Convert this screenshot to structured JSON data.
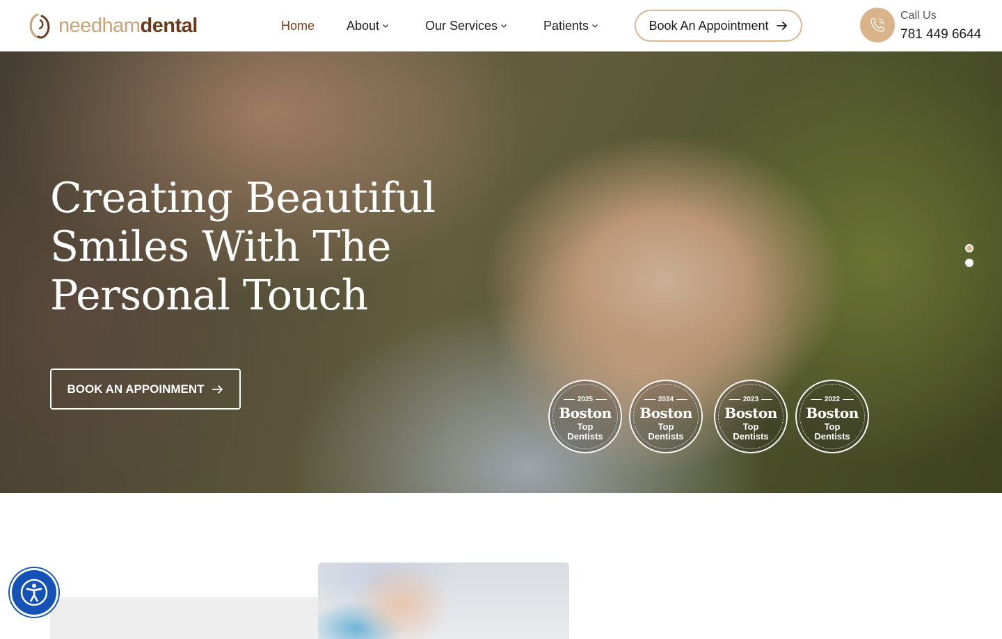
{
  "brand": {
    "logo_part1": "needham",
    "logo_part2": "dental",
    "colors": {
      "accent": "#d9b38a",
      "brand_dark": "#6a3b1a",
      "brand_light": "#c7a27a",
      "accessibility": "#1552b8"
    }
  },
  "nav": {
    "items": [
      {
        "label": "Home",
        "active": true,
        "dropdown": false
      },
      {
        "label": "About",
        "active": false,
        "dropdown": true
      },
      {
        "label": "Our Services",
        "active": false,
        "dropdown": true
      },
      {
        "label": "Patients",
        "active": false,
        "dropdown": true
      }
    ],
    "cta_label": "Book An Appointment"
  },
  "contact": {
    "label": "Call Us",
    "phone": "781 449 6644",
    "icon": "phone-icon"
  },
  "hero": {
    "title_lines": [
      "Creating Beautiful",
      "Smiles With The",
      "Personal Touch"
    ],
    "cta_label": "BOOK AN APPOINMENT",
    "slides": {
      "count": 2,
      "active_index": 0
    },
    "badges": [
      {
        "year": "2025",
        "brand": "Boston",
        "line1": "Top",
        "line2": "Dentists"
      },
      {
        "year": "2024",
        "brand": "Boston",
        "line1": "Top",
        "line2": "Dentists"
      },
      {
        "year": "2023",
        "brand": "Boston",
        "line1": "Top",
        "line2": "Dentists"
      },
      {
        "year": "2022",
        "brand": "Boston",
        "line1": "Top",
        "line2": "Dentists"
      }
    ]
  },
  "accessibility": {
    "icon": "accessibility-icon"
  }
}
